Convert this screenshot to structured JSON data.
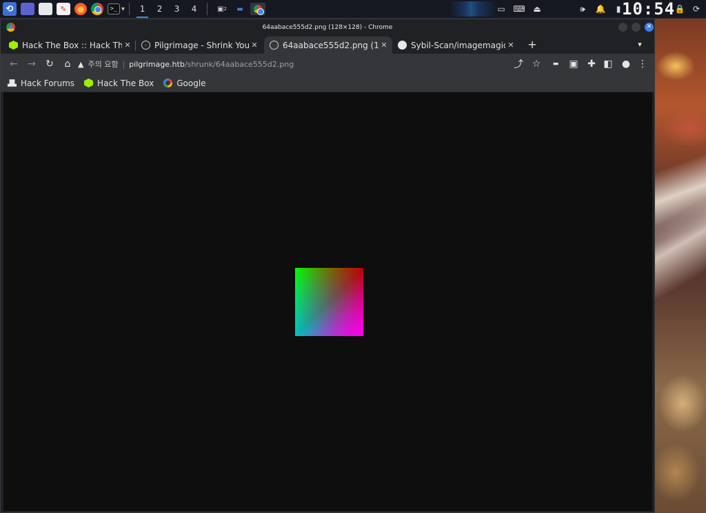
{
  "panel": {
    "workspaces": [
      "1",
      "2",
      "3",
      "4"
    ],
    "active_workspace": "1",
    "clock": "10:54",
    "task_badge": "2"
  },
  "window": {
    "title": "64aabace555d2.png (128×128) - Chrome"
  },
  "tabs": [
    {
      "label": "Hack The Box :: Hack The Box",
      "icon": "htb-cube-icon",
      "active": false
    },
    {
      "label": "Pilgrimage - Shrink Your Images",
      "icon": "globe-icon",
      "active": false
    },
    {
      "label": "64aabace555d2.png (128×128)",
      "icon": "globe-icon",
      "active": true
    },
    {
      "label": "Sybil-Scan/imagemagick-lfi-poc",
      "icon": "github-icon",
      "active": false
    }
  ],
  "omnibox": {
    "security_label": "주의 요함",
    "host": "pilgrimage.htb",
    "path": "/shrunk/64aabace555d2.png"
  },
  "bookmarks": [
    {
      "label": "Hack Forums",
      "icon": "hackforums-icon"
    },
    {
      "label": "Hack The Box",
      "icon": "htb-cube-icon"
    },
    {
      "label": "Google",
      "icon": "google-icon"
    }
  ],
  "image": {
    "natural_width": 128,
    "natural_height": 128,
    "colors": {
      "top_left": "#00ff00",
      "top_right": "#ff0000",
      "bottom_left": "#0000ff",
      "bottom_right": "#ff00ff"
    }
  },
  "colors": {
    "accent": "#3d7de8",
    "viewport_bg": "#0e0e0e",
    "toolbar_bg": "#35363a"
  }
}
